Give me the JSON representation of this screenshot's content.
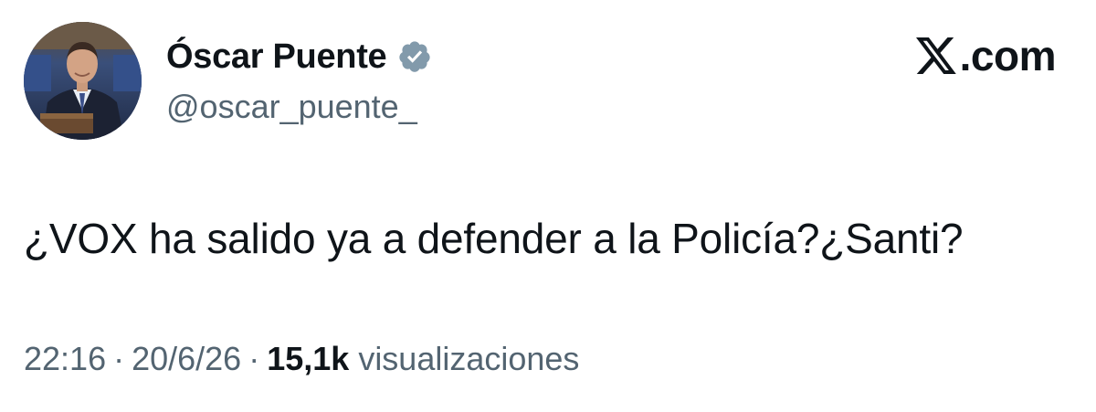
{
  "author": {
    "display_name": "Óscar Puente",
    "handle": "@oscar_puente_",
    "verified": true,
    "avatar_icon": "profile-photo"
  },
  "brand": {
    "label": ".com",
    "logo_icon": "x-logo-icon"
  },
  "tweet": {
    "text": "¿VOX ha salido ya a defender a la Policía?¿Santi?"
  },
  "meta": {
    "time": "22:16",
    "date": "20/6/26",
    "separator": "·",
    "views_count": "15,1k",
    "views_label": "visualizaciones"
  },
  "colors": {
    "text_primary": "#0f1419",
    "text_secondary": "#536471",
    "verified_badge": "#829aab"
  }
}
